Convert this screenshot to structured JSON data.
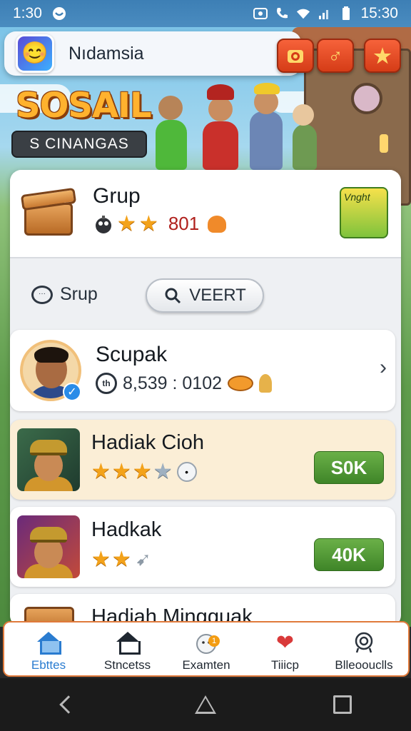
{
  "status_bar": {
    "time_left": "1:30",
    "time_right": "15:30"
  },
  "header": {
    "app_title": "Nıdamsia",
    "logo_icon": "smiley-face-icon"
  },
  "banner": {
    "brand": "SOSAIL",
    "subtitle": "S CINANGAS"
  },
  "group": {
    "title": "Grup",
    "score": "801",
    "tile_text": "Vnght"
  },
  "search_row": {
    "label": "Srup",
    "button_label": "VEERT"
  },
  "profile": {
    "name": "Scupak",
    "stats": "8,539 : 0102",
    "coin_glyph": "th"
  },
  "rewards": [
    {
      "title": "Hadiak Cioh",
      "button": "S0K",
      "stars_filled": 3,
      "stars_empty": 1
    },
    {
      "title": "Hadkak",
      "button": "40K",
      "stars_filled": 2,
      "stars_empty": 0
    }
  ],
  "peek_item": {
    "title": "Hadiah Mingguak"
  },
  "bottom_nav": [
    {
      "label": "Ebttes",
      "icon": "home-icon",
      "active": true
    },
    {
      "label": "Stncetss",
      "icon": "house-outline-icon",
      "active": false
    },
    {
      "label": "Examten",
      "icon": "snowman-icon",
      "active": false
    },
    {
      "label": "Tiiicp",
      "icon": "heart-icon",
      "active": false
    },
    {
      "label": "Blleoouclls",
      "icon": "target-icon",
      "active": false
    }
  ],
  "colors": {
    "accent_orange": "#e84a1f",
    "claim_green": "#4f9a32",
    "active_blue": "#2a7cd0"
  }
}
